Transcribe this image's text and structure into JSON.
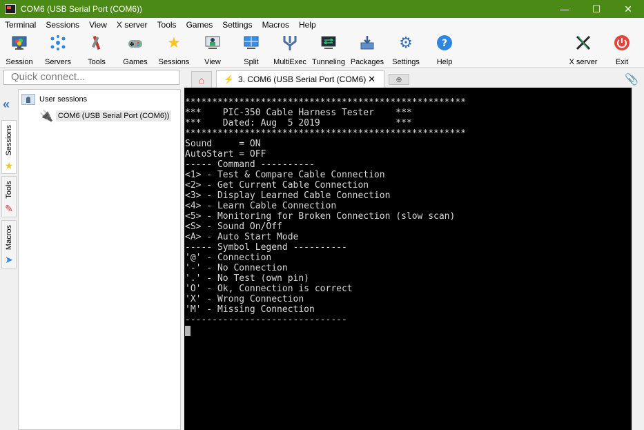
{
  "window": {
    "title": "COM6  (USB Serial Port (COM6))",
    "controls": {
      "minimize": "—",
      "maximize": "☐",
      "close": "✕"
    }
  },
  "menu": [
    "Terminal",
    "Sessions",
    "View",
    "X server",
    "Tools",
    "Games",
    "Settings",
    "Macros",
    "Help"
  ],
  "toolbar": {
    "session": "Session",
    "servers": "Servers",
    "tools": "Tools",
    "games": "Games",
    "sessions": "Sessions",
    "view": "View",
    "split": "Split",
    "multiexec": "MultiExec",
    "tunneling": "Tunneling",
    "packages": "Packages",
    "settings": "Settings",
    "help": "Help",
    "xserver": "X server",
    "exit": "Exit"
  },
  "quick_connect": {
    "placeholder": "Quick connect..."
  },
  "tabs": {
    "active_label": "3. COM6  (USB Serial Port (COM6)",
    "close": "✕"
  },
  "side_tabs": {
    "sessions": "Sessions",
    "tools": "Tools",
    "macros": "Macros"
  },
  "sessions_tree": {
    "root": "User sessions",
    "items": [
      "COM6  (USB Serial Port (COM6))"
    ]
  },
  "terminal": {
    "lines": [
      "****************************************************",
      "***    PIC-350 Cable Harness Tester    ***",
      "***    Dated: Aug  5 2019              ***",
      "****************************************************",
      "Sound     = ON",
      "AutoStart = OFF",
      "----- Command ----------",
      "<1> - Test & Compare Cable Connection",
      "<2> - Get Current Cable Connection",
      "<3> - Display Learned Cable Connection",
      "<4> - Learn Cable Connection",
      "<5> - Monitoring for Broken Connection (slow scan)",
      "<S> - Sound On/Off",
      "<A> - Auto Start Mode",
      "----- Symbol Legend ----------",
      "'@' - Connection",
      "'-' - No Connection",
      "'.' - No Test (own pin)",
      "'O' - Ok, Connection is correct",
      "'X' - Wrong Connection",
      "'M' - Missing Connection",
      "------------------------------"
    ]
  }
}
